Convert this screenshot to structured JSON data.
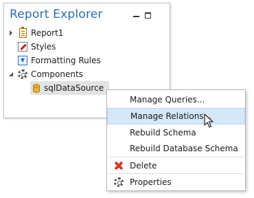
{
  "panel": {
    "title": "Report Explorer",
    "tree": [
      {
        "label": "Report1",
        "icon": "report-icon",
        "expander": "collapsed"
      },
      {
        "label": "Styles",
        "icon": "styles-icon"
      },
      {
        "label": "Formatting Rules",
        "icon": "formatting-rules-icon"
      },
      {
        "label": "Components",
        "icon": "gear-icon",
        "expander": "expanded"
      },
      {
        "label": "sqlDataSource",
        "icon": "database-icon",
        "selected": true
      }
    ]
  },
  "context_menu": {
    "items": [
      {
        "label": "Manage Queries..."
      },
      {
        "label": "Manage Relations...",
        "hovered": true
      },
      {
        "label": "Rebuild Schema"
      },
      {
        "label": "Rebuild Database Schema"
      },
      {
        "label": "Delete",
        "icon": "delete-icon"
      },
      {
        "label": "Properties",
        "icon": "properties-icon"
      }
    ]
  },
  "colors": {
    "title": "#2b6cb0",
    "hover_bg": "#d4e8fa",
    "selected_bg": "#e3e3e3",
    "delete_icon": "#d23a2a"
  }
}
